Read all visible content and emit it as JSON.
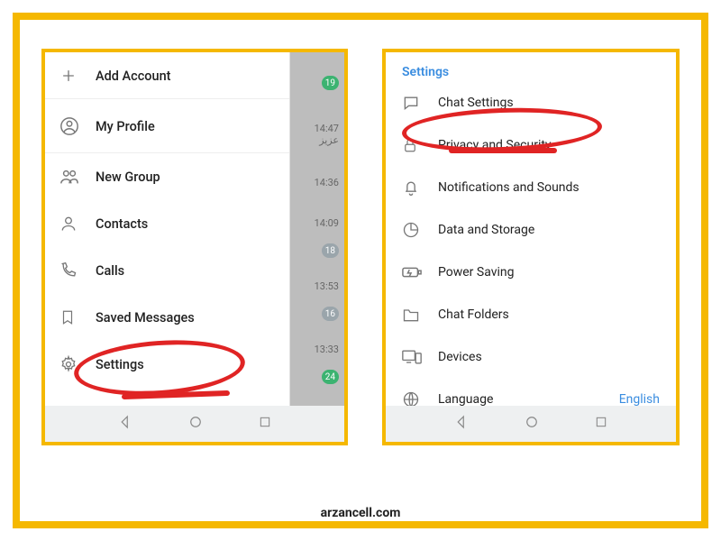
{
  "watermark": "arzancell.com",
  "drawer": {
    "items": [
      {
        "label": "Add Account"
      },
      {
        "label": "My Profile"
      },
      {
        "label": "New Group"
      },
      {
        "label": "Contacts"
      },
      {
        "label": "Calls"
      },
      {
        "label": "Saved Messages"
      },
      {
        "label": "Settings"
      }
    ]
  },
  "chat_peek": {
    "rows": [
      {
        "time": "",
        "badge": "19",
        "badge_color": "green"
      },
      {
        "time": "14:47",
        "extra": "عزیز"
      },
      {
        "time": "14:36"
      },
      {
        "time": "14:09",
        "badge": "18",
        "badge_color": "gray"
      },
      {
        "time": "13:53",
        "badge": "16",
        "badge_color": "gray"
      },
      {
        "time": "13:33",
        "badge": "24",
        "badge_color": "green"
      }
    ]
  },
  "settings": {
    "header": "Settings",
    "items": [
      {
        "label": "Chat Settings"
      },
      {
        "label": "Privacy and Security"
      },
      {
        "label": "Notifications and Sounds"
      },
      {
        "label": "Data and Storage"
      },
      {
        "label": "Power Saving"
      },
      {
        "label": "Chat Folders"
      },
      {
        "label": "Devices"
      },
      {
        "label": "Language",
        "value": "English"
      }
    ]
  }
}
